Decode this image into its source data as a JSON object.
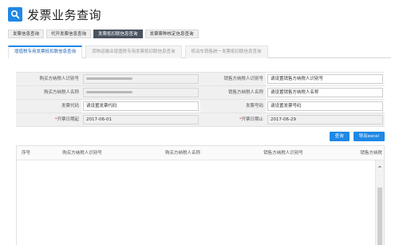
{
  "header": {
    "title": "发票业务查询",
    "logo_icon": "search-icon",
    "accent": "#1e88e5"
  },
  "top_tabs": [
    {
      "label": "发票信息查询",
      "active": false
    },
    {
      "label": "代开发票信息查询",
      "active": false
    },
    {
      "label": "发票抵扣联信息查询",
      "active": true
    },
    {
      "label": "发票票种核定信息查询",
      "active": false
    }
  ],
  "sub_tabs": [
    {
      "label": "增值税专用发票抵扣联信息查询",
      "active": true
    },
    {
      "label": "货物运输业增值税专用发票抵扣联信息查询",
      "active": false
    },
    {
      "label": "机动车销售统一发票抵扣联信息查询",
      "active": false
    }
  ],
  "form": {
    "buyer_tax_id_label": "购买方纳税人识别号",
    "buyer_name_label": "购买方纳税人名称",
    "invoice_code_label": "发票代码",
    "invoice_code_placeholder": "请设置发票代码",
    "start_date_label": "开票日期起",
    "start_date_value": "2017-06-01",
    "seller_tax_id_label": "销售方纳税人识别号",
    "seller_tax_id_placeholder": "请设置销售方纳税人识别号",
    "seller_name_label": "销售方纳税人名称",
    "seller_name_placeholder": "请设置销售方纳税人名称",
    "invoice_number_label": "发票号码",
    "invoice_number_placeholder": "请设置发票号码",
    "end_date_label": "开票日期止",
    "end_date_value": "2017-06-29",
    "required_mark": "*"
  },
  "buttons": {
    "query": "查询",
    "export": "导出excel"
  },
  "table": {
    "columns": [
      "序号",
      "购买方纳税人识别号",
      "购买方纳税人名称",
      "销售方纳税人识别号",
      "销售方纳税"
    ]
  }
}
